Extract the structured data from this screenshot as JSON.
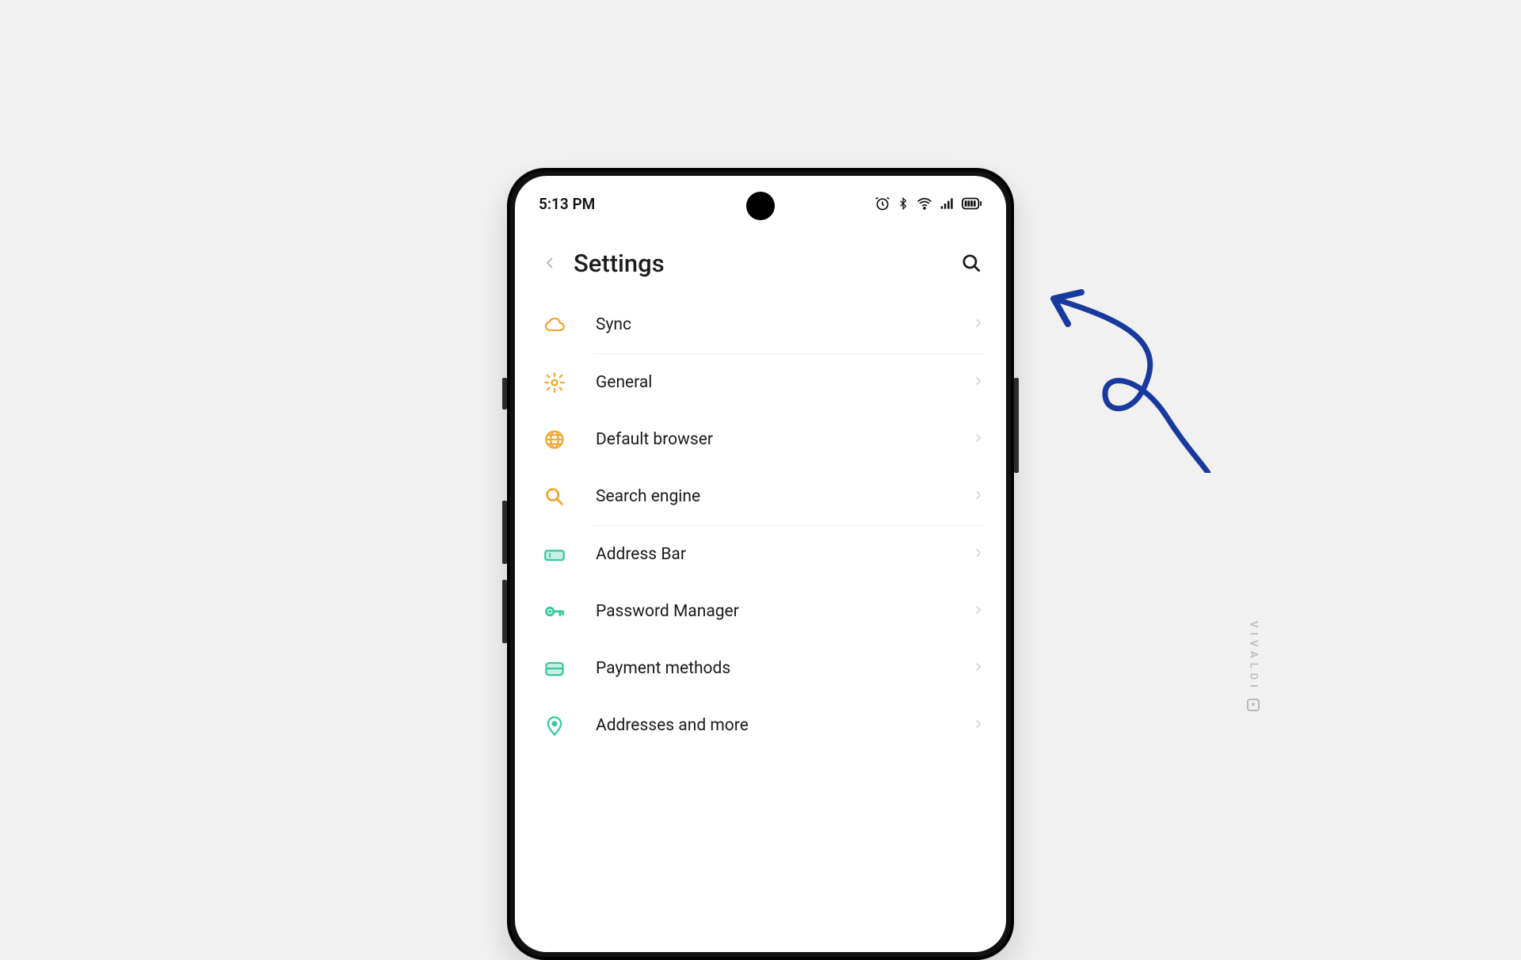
{
  "statusbar": {
    "time": "5:13 PM"
  },
  "header": {
    "title": "Settings"
  },
  "settings_items": [
    {
      "label": "Sync",
      "icon": "cloud-icon",
      "color": "#f0a935"
    },
    {
      "label": "General",
      "icon": "gear-icon",
      "color": "#f0a935"
    },
    {
      "label": "Default browser",
      "icon": "globe-icon",
      "color": "#f0a935"
    },
    {
      "label": "Search engine",
      "icon": "search-icon",
      "color": "#f0a935"
    },
    {
      "label": "Address Bar",
      "icon": "address-bar-icon",
      "color": "#3bc9a1"
    },
    {
      "label": "Password Manager",
      "icon": "key-icon",
      "color": "#3bc9a1"
    },
    {
      "label": "Payment methods",
      "icon": "card-icon",
      "color": "#3bc9a1"
    },
    {
      "label": "Addresses and more",
      "icon": "pin-icon",
      "color": "#3bc9a1"
    }
  ],
  "dividers_after": [
    0,
    3
  ],
  "annotation": {
    "arrow_color": "#183a9e"
  },
  "watermark": {
    "text": "VIVALDI"
  }
}
